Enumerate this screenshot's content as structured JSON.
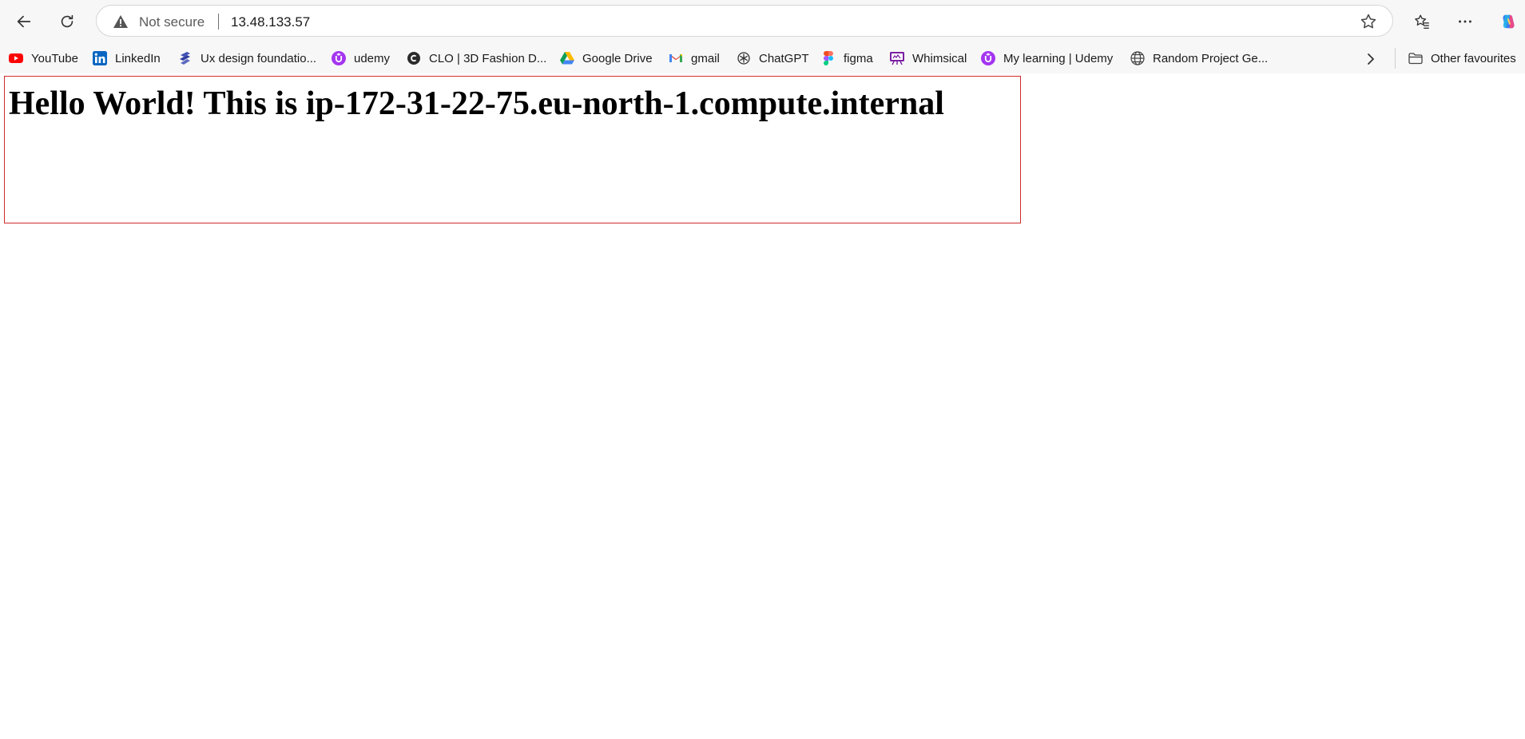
{
  "browser": {
    "security_label": "Not secure",
    "url": "13.48.133.57",
    "icons": {
      "back": "back-arrow-icon",
      "reload": "reload-icon",
      "warning": "warning-icon",
      "star": "star-icon",
      "favorites": "favorites-icon",
      "menu": "more-icon",
      "copilot": "copilot-icon"
    }
  },
  "bookmarks": {
    "items": [
      {
        "label": "YouTube",
        "icon": "youtube-icon"
      },
      {
        "label": "LinkedIn",
        "icon": "linkedin-icon"
      },
      {
        "label": "Ux design foundatio...",
        "icon": "coursera-icon"
      },
      {
        "label": "udemy",
        "icon": "udemy-icon"
      },
      {
        "label": "CLO | 3D Fashion D...",
        "icon": "clo-icon"
      },
      {
        "label": "Google Drive",
        "icon": "google-drive-icon"
      },
      {
        "label": "gmail",
        "icon": "gmail-icon"
      },
      {
        "label": "ChatGPT",
        "icon": "chatgpt-icon"
      },
      {
        "label": "figma",
        "icon": "figma-icon"
      },
      {
        "label": "Whimsical",
        "icon": "whimsical-icon"
      },
      {
        "label": "My learning | Udemy",
        "icon": "udemy-icon"
      },
      {
        "label": "Random Project Ge...",
        "icon": "globe-icon"
      }
    ],
    "other": {
      "label": "Other favourites",
      "icon": "folder-icon"
    }
  },
  "page": {
    "heading": "Hello World! This is ip-172-31-22-75.eu-north-1.compute.internal"
  },
  "colors": {
    "toolbar_bg": "#f7f7f7",
    "box_border": "#d22a2a",
    "udemy_purple": "#a435f0"
  }
}
